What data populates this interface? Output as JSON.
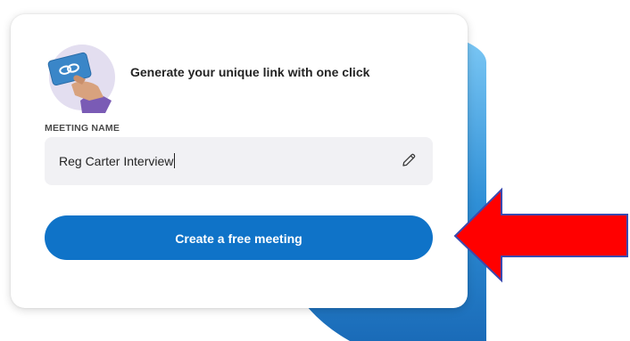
{
  "card": {
    "headline": "Generate your unique link with one click",
    "meeting_name_label": "MEETING NAME",
    "meeting_name_value": "Reg Carter Interview",
    "create_button_label": "Create a free meeting"
  },
  "icons": {
    "illustration": "hand-holding-link-card-icon",
    "edit": "pencil-icon",
    "annotation": "red-arrow-pointing-left"
  },
  "colors": {
    "button": "#0f73c8",
    "input_bg": "#f1f1f4",
    "arrow": "#ff0000",
    "arrow_border": "#3a4ab0",
    "bg_shape_top": "#7cc8f5",
    "bg_shape_bottom": "#1a6bb8",
    "illustration_circle": "#e3def0"
  }
}
